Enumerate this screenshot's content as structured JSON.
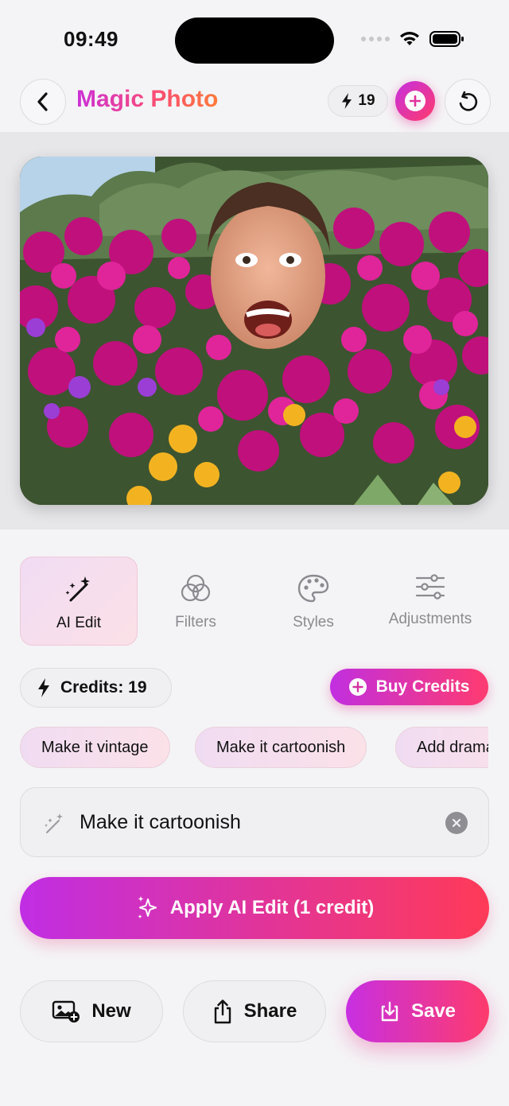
{
  "status_bar": {
    "time": "09:49"
  },
  "header": {
    "title": "Magic Photo",
    "credit_count": "19"
  },
  "photo": {
    "description_icon": "edited-photo"
  },
  "tabs": [
    {
      "label": "AI Edit",
      "icon": "magic-wand-icon",
      "active": true
    },
    {
      "label": "Filters",
      "icon": "filters-icon",
      "active": false
    },
    {
      "label": "Styles",
      "icon": "palette-icon",
      "active": false
    },
    {
      "label": "Adjustments",
      "icon": "sliders-icon",
      "active": false
    }
  ],
  "credits": {
    "label": "Credits: 19",
    "buy_label": "Buy Credits"
  },
  "suggestions": [
    "Make it vintage",
    "Make it cartoonish",
    "Add dramatic"
  ],
  "prompt": {
    "value": "Make it cartoonish"
  },
  "apply": {
    "label": "Apply AI Edit (1 credit)"
  },
  "actions": {
    "new_label": "New",
    "share_label": "Share",
    "save_label": "Save"
  },
  "colors": {
    "accent_start": "#c12fe0",
    "accent_end": "#ff3b6c",
    "background": "#f4f4f6"
  }
}
